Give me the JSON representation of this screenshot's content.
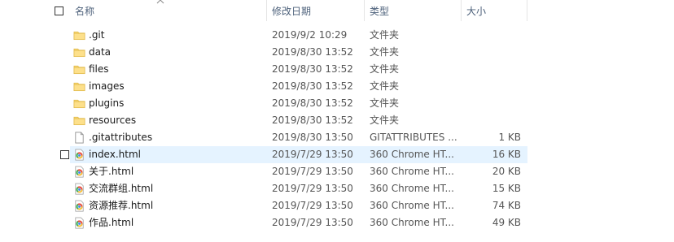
{
  "header": {
    "name": "名称",
    "date": "修改日期",
    "type": "类型",
    "size": "大小"
  },
  "files": [
    {
      "name": ".git",
      "date": "2019/9/2 10:29",
      "type": "文件夹",
      "size": "",
      "icon": "folder-icon"
    },
    {
      "name": "data",
      "date": "2019/8/30 13:52",
      "type": "文件夹",
      "size": "",
      "icon": "folder-icon"
    },
    {
      "name": "files",
      "date": "2019/8/30 13:52",
      "type": "文件夹",
      "size": "",
      "icon": "folder-icon"
    },
    {
      "name": "images",
      "date": "2019/8/30 13:52",
      "type": "文件夹",
      "size": "",
      "icon": "folder-icon"
    },
    {
      "name": "plugins",
      "date": "2019/8/30 13:52",
      "type": "文件夹",
      "size": "",
      "icon": "folder-icon"
    },
    {
      "name": "resources",
      "date": "2019/8/30 13:52",
      "type": "文件夹",
      "size": "",
      "icon": "folder-icon"
    },
    {
      "name": ".gitattributes",
      "date": "2019/8/30 13:50",
      "type": "GITATTRIBUTES ...",
      "size": "1 KB",
      "icon": "file-icon"
    },
    {
      "name": "index.html",
      "date": "2019/7/29 13:50",
      "type": "360 Chrome HT...",
      "size": "16 KB",
      "icon": "browser-icon",
      "selected": true
    },
    {
      "name": "关于.html",
      "date": "2019/7/29 13:50",
      "type": "360 Chrome HT...",
      "size": "20 KB",
      "icon": "browser-icon"
    },
    {
      "name": "交流群组.html",
      "date": "2019/7/29 13:50",
      "type": "360 Chrome HT...",
      "size": "15 KB",
      "icon": "browser-icon"
    },
    {
      "name": "资源推荐.html",
      "date": "2019/7/29 13:50",
      "type": "360 Chrome HT...",
      "size": "74 KB",
      "icon": "browser-icon"
    },
    {
      "name": "作品.html",
      "date": "2019/7/29 13:50",
      "type": "360 Chrome HT...",
      "size": "49 KB",
      "icon": "browser-icon"
    }
  ]
}
